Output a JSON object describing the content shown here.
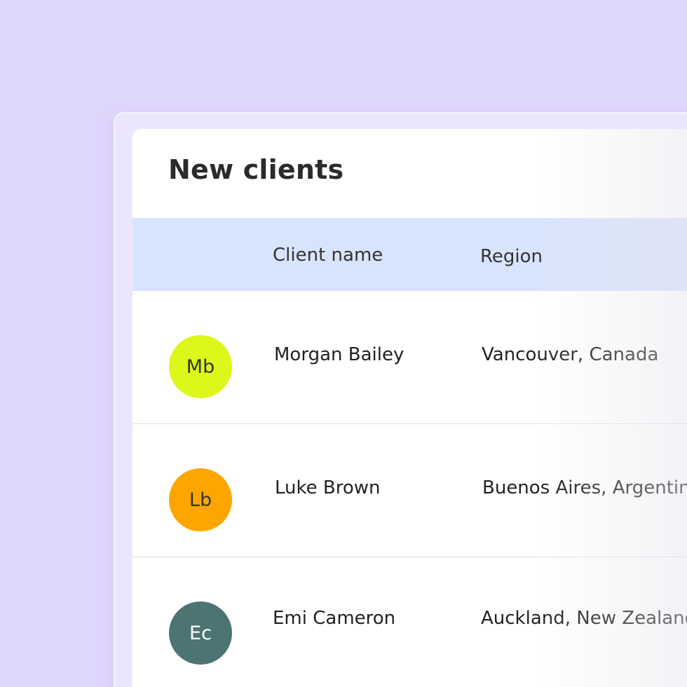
{
  "title": "New clients",
  "columns": {
    "name": "Client name",
    "region": "Region"
  },
  "rows": [
    {
      "initials": "Mb",
      "name": "Morgan Bailey",
      "region": "Vancouver, Canada",
      "avatar_color": "#ddf71a",
      "initials_color": "#333333"
    },
    {
      "initials": "Lb",
      "name": "Luke Brown",
      "region": "Buenos Aires, Argentina",
      "avatar_color": "#ffa500",
      "initials_color": "#333333"
    },
    {
      "initials": "Ec",
      "name": "Emi Cameron",
      "region": "Auckland, New Zealand",
      "avatar_color": "#4c7472",
      "initials_color": "#ffffff"
    }
  ]
}
